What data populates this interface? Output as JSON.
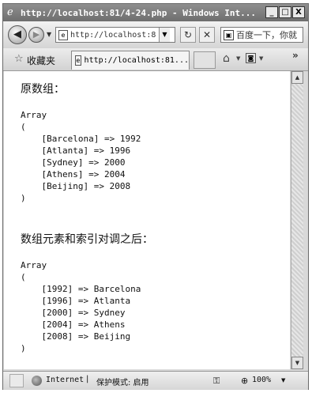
{
  "window": {
    "title": "http://localhost:81/4-24.php - Windows Int...",
    "controls": [
      "_",
      "□",
      "X"
    ]
  },
  "nav": {
    "address": "http://localhost:8",
    "search_text": "百度一下，你就"
  },
  "favorites": {
    "label": "收藏夹",
    "tab_title": "http://localhost:81..."
  },
  "content": {
    "heading1": "原数组：",
    "original_array": "Array\n(\n    [Barcelona] => 1992\n    [Atlanta] => 1996\n    [Sydney] => 2000\n    [Athens] => 2004\n    [Beijing] => 2008\n)",
    "heading2": "数组元素和索引对调之后：",
    "flipped_array": "Array\n(\n    [1992] => Barcelona\n    [1996] => Atlanta\n    [2000] => Sydney\n    [2004] => Athens\n    [2008] => Beijing\n)"
  },
  "status": {
    "zone": "Internet",
    "separator": "|",
    "protected_mode": "保护模式: 启用",
    "zoom": "100%"
  }
}
